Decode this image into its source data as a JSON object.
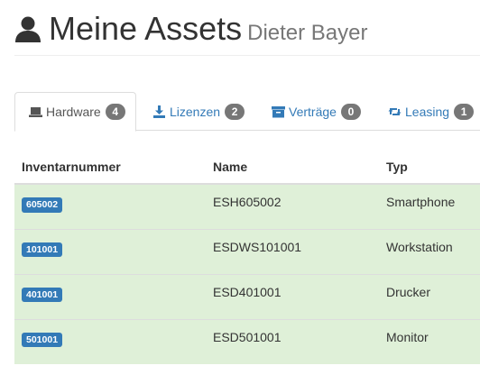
{
  "header": {
    "title": "Meine Assets",
    "subtitle": "Dieter Bayer",
    "icon": "user-icon"
  },
  "tabs": [
    {
      "label": "Hardware",
      "count": "4",
      "icon": "laptop-icon",
      "active": true
    },
    {
      "label": "Lizenzen",
      "count": "2",
      "icon": "download-icon",
      "active": false
    },
    {
      "label": "Verträge",
      "count": "0",
      "icon": "archive-icon",
      "active": false
    },
    {
      "label": "Leasing",
      "count": "1",
      "icon": "retweet-icon",
      "active": false
    }
  ],
  "table": {
    "headers": [
      "Inventarnummer",
      "Name",
      "Typ"
    ],
    "rows": [
      {
        "inventory": "605002",
        "name": "ESH605002",
        "type": "Smartphone"
      },
      {
        "inventory": "101001",
        "name": "ESDWS101001",
        "type": "Workstation"
      },
      {
        "inventory": "401001",
        "name": "ESD401001",
        "type": "Drucker"
      },
      {
        "inventory": "501001",
        "name": "ESD501001",
        "type": "Monitor"
      }
    ]
  },
  "colors": {
    "link": "#337ab7",
    "row_success": "#dff0d8",
    "badge": "#777777",
    "label_primary": "#337ab7"
  }
}
